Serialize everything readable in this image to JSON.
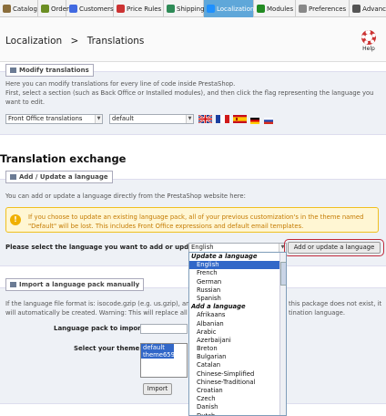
{
  "tabs": [
    {
      "label": "Catalog",
      "icon": "catalog-icon",
      "color": "#8a6d3b"
    },
    {
      "label": "Orders",
      "icon": "orders-icon",
      "color": "#6b8e23"
    },
    {
      "label": "Customers",
      "icon": "customers-icon",
      "color": "#4169e1"
    },
    {
      "label": "Price Rules",
      "icon": "price-rules-icon",
      "color": "#cc3333"
    },
    {
      "label": "Shipping",
      "icon": "shipping-icon",
      "color": "#2e8b57"
    },
    {
      "label": "Localization",
      "icon": "localization-icon",
      "color": "#1e90ff",
      "active": true
    },
    {
      "label": "Modules",
      "icon": "modules-icon",
      "color": "#228b22"
    },
    {
      "label": "Preferences",
      "icon": "preferences-icon",
      "color": "#888888"
    },
    {
      "label": "Advanced",
      "icon": "advanced-icon",
      "color": "#555555"
    }
  ],
  "header": {
    "section": "Localization",
    "separator": ">",
    "page": "Translations",
    "help_label": "Help"
  },
  "modify": {
    "legend": "Modify translations",
    "desc1": "Here you can modify translations for every line of code inside PrestaShop.",
    "desc2": "First, select a section (such as Back Office or Installed modules), and then click the flag representing the language you",
    "desc3": "want to edit.",
    "type_select": "Front Office translations",
    "theme_select": "default",
    "flags": [
      "english-flag",
      "french-flag",
      "spanish-flag",
      "german-flag",
      "russian-flag"
    ]
  },
  "exchange": {
    "title": "Translation exchange",
    "legend": "Add / Update a language",
    "desc": "You can add or update a language directly from the PrestaShop website here:",
    "warning": "If you choose to update an existing language pack, all of your previous customization's in the theme named \"Default\" will be lost. This includes Front Office expressions and default email templates.",
    "select_label": "Please select the language you want to add or update:",
    "selected_language": "English",
    "button": "Add or update a language",
    "dropdown": {
      "group_update": "Update a language",
      "update_languages": [
        "English",
        "French",
        "German",
        "Russian",
        "Spanish"
      ],
      "group_add": "Add a language",
      "add_languages": [
        "Afrikaans",
        "Albanian",
        "Arabic",
        "Azerbaijani",
        "Breton",
        "Bulgarian",
        "Catalan",
        "Chinese-Simplified",
        "Chinese-Traditional",
        "Croatian",
        "Czech",
        "Danish",
        "Dutch"
      ]
    }
  },
  "import": {
    "legend": "Import a language pack manually",
    "desc1_a": "If the language file format is: isocode.gzip (e.g. us.gzip), and",
    "desc1_b": "this package does not exist, it",
    "desc2_a": "will automatically be created. Warning: This will replace all of",
    "desc2_b": "tination language.",
    "pack_label": "Language pack to import:",
    "theme_label": "Select your theme:",
    "themes": [
      "default",
      "theme659"
    ],
    "button": "Import"
  }
}
